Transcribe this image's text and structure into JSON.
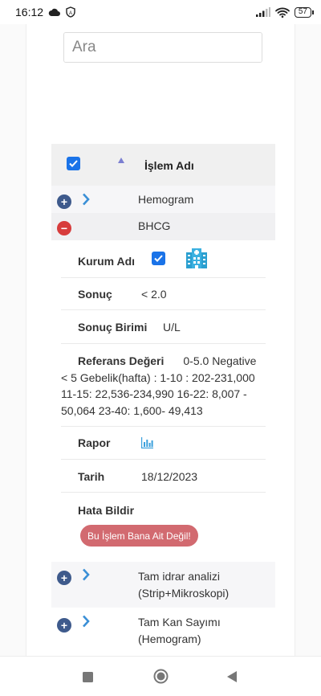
{
  "status_bar": {
    "time": "16:12",
    "battery": "57"
  },
  "search": {
    "placeholder": "Ara"
  },
  "table": {
    "header_label": "İşlem Adı",
    "rows": [
      {
        "label": "Hemogram"
      },
      {
        "label": "BHCG"
      },
      {
        "label": "Tam idrar analizi (Strip+Mikroskopi)"
      },
      {
        "label": "Tam Kan Sayımı (Hemogram)"
      }
    ]
  },
  "detail": {
    "kurum_label": "Kurum Adı",
    "sonuc_label": "Sonuç",
    "sonuc_value": "< 2.0",
    "birim_label": "Sonuç Birimi",
    "birim_value": "U/L",
    "referans_label": "Referans Değeri",
    "referans_value_line1": "0-5.0 Negative <",
    "referans_value_rest": "5 Gebelik(hafta) : 1-10 : 202-231,000 11-15: 22,536-234,990 16-22: 8,007 - 50,064 23-40: 1,600- 49,413",
    "rapor_label": "Rapor",
    "tarih_label": "Tarih",
    "tarih_value": "18/12/2023",
    "hata_label": "Hata Bildir",
    "hata_button": "Bu İşlem Bana Ait Değil!"
  },
  "colors": {
    "accent": "#1a73e8",
    "plus": "#3e5a8c",
    "minus": "#d73c3c",
    "error_btn": "#d26a70",
    "chevron": "#3a8fd6"
  }
}
